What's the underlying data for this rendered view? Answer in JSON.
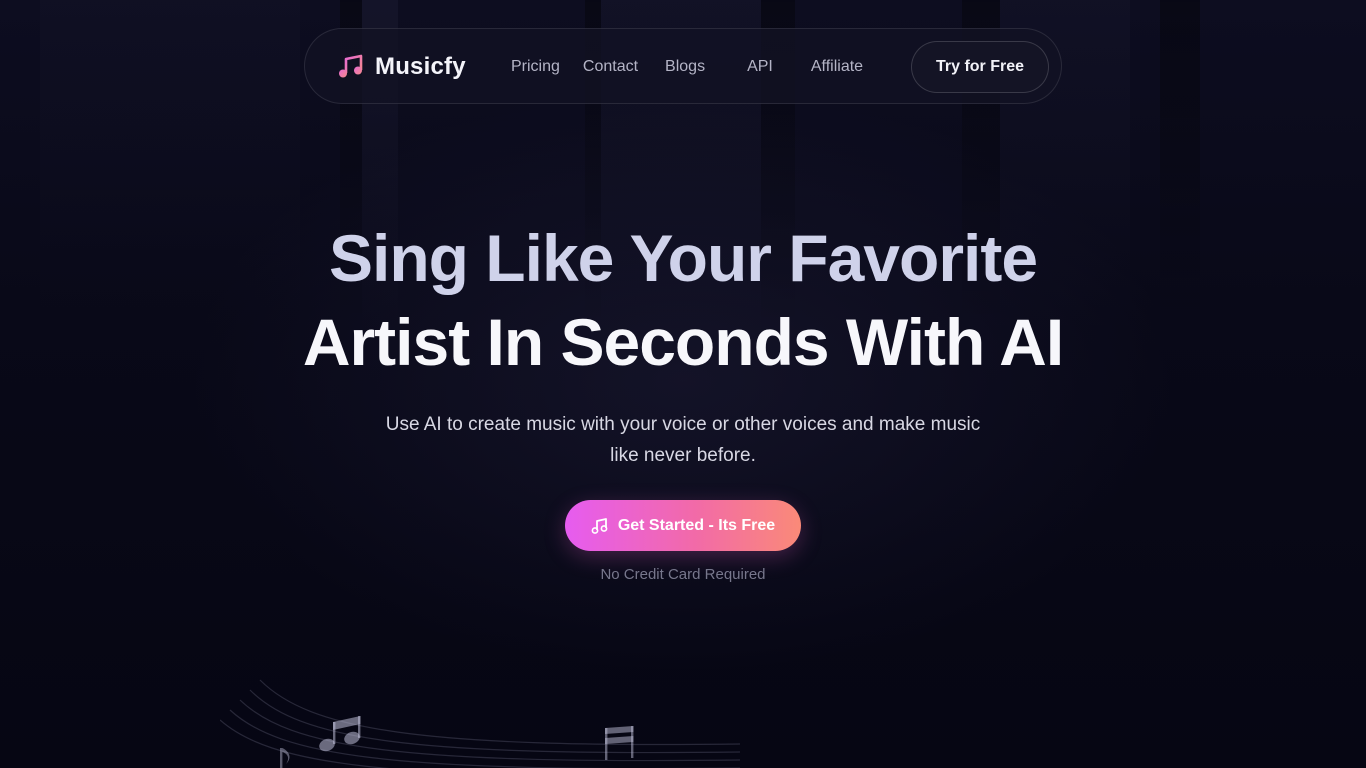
{
  "nav": {
    "brand": {
      "name": "Musicfy",
      "icon": "music-note-icon"
    },
    "links": [
      {
        "label": "Pricing"
      },
      {
        "label": "Contact"
      },
      {
        "label": "Blogs"
      },
      {
        "label": "API"
      },
      {
        "label": "Affiliate"
      }
    ],
    "cta_label": "Try for Free"
  },
  "hero": {
    "title_line1": "Sing Like Your Favorite",
    "title_line2": "Artist In Seconds With AI",
    "subtitle": "Use AI to create music with your voice or other voices and make music like never before.",
    "cta": {
      "label": "Get Started - Its Free",
      "icon": "music-note-icon"
    },
    "note": "No Credit Card Required"
  },
  "colors": {
    "background": "#080818",
    "accent_gradient_start": "#e65cf0",
    "accent_gradient_end": "#fa8a78",
    "brand_icon_start": "#e86ad2",
    "brand_icon_end": "#f58a8a"
  }
}
